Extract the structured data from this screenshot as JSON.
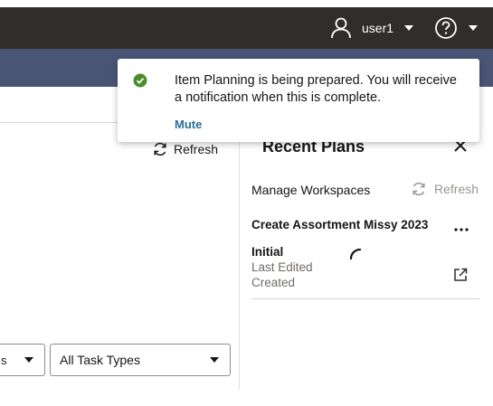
{
  "header": {
    "user_name": "user1",
    "user_icon": "user-icon",
    "help_icon": "help-icon"
  },
  "notification": {
    "status_icon": "check-circle-icon",
    "status_color": "#4c8c2b",
    "message": "Item Planning is being prepared. You will receive a notification when this is complete.",
    "mute_label": "Mute",
    "mute_color": "#2a6f97"
  },
  "main": {
    "refresh_label": "Refresh",
    "filters": [
      {
        "value": "s"
      },
      {
        "value": "All Task Types"
      }
    ]
  },
  "recent_plans": {
    "title": "Recent Plans",
    "manage_workspaces_label": "Manage Workspaces",
    "refresh_label": "Refresh",
    "plans": [
      {
        "title": "Create Assortment Missy 2023",
        "status": "Initial",
        "last_edited_label": "Last Edited",
        "created_label": "Created"
      }
    ]
  },
  "colors": {
    "topbar": "#312d2a",
    "subbar": "#4a5576"
  }
}
